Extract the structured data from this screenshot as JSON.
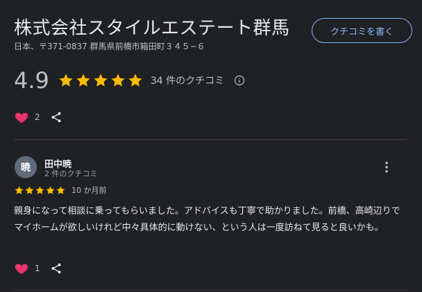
{
  "business": {
    "name": "株式会社スタイルエステート群馬",
    "address": "日本、〒371-0837 群馬県前橋市箱田町３４５−６",
    "write_review_label": "クチコミを書く"
  },
  "summary": {
    "rating": "4.9",
    "stars": 5,
    "review_count_label": "34 件のクチコミ",
    "like_count": "2"
  },
  "review": {
    "avatar_letter": "暁",
    "reviewer_name": "田中暁",
    "reviewer_meta": "2 件のクチコミ",
    "stars": 5,
    "date": "10 か月前",
    "text": "親身になって相談に乗ってもらいました。アドバイスも丁寧で助かりました。前橋、高崎辺りでマイホームが欲しいけれど中々具体的に動けない、という人は一度訪ねて見ると良いかも。",
    "like_count": "1"
  },
  "colors": {
    "background": "#202124",
    "star": "#fbbc04",
    "accent": "#8ab4f8",
    "heart": "#e8336d",
    "avatar": "#5f6b7a"
  },
  "icons": {
    "star": "star-icon",
    "info": "info-icon",
    "heart": "heart-icon",
    "share": "share-icon",
    "more": "more-vert-icon"
  }
}
